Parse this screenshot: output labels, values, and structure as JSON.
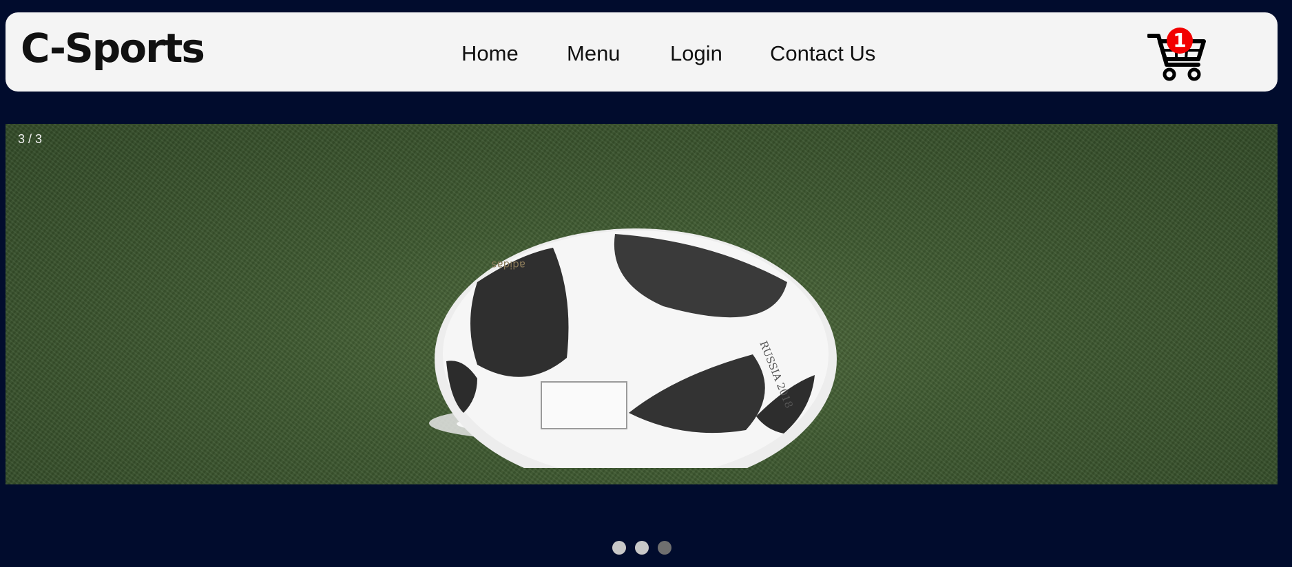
{
  "header": {
    "brand": "C-Sports",
    "nav": [
      {
        "label": "Home"
      },
      {
        "label": "Menu"
      },
      {
        "label": "Login"
      },
      {
        "label": "Contact Us"
      }
    ],
    "cart": {
      "icon": "cart-icon",
      "count": "1"
    }
  },
  "slideshow": {
    "counter": "3 / 3",
    "slide_image": "soccer-ball-on-pitch",
    "ball_print": "RUSSIA 2018",
    "ball_brand": "adidas",
    "active_index": 3,
    "dots": [
      {
        "index": 1
      },
      {
        "index": 2
      },
      {
        "index": 3
      }
    ]
  },
  "colors": {
    "page_bg": "#010c2d",
    "nav_bg": "#f4f4f4",
    "badge": "#f20000",
    "dot": "#c8c8c8",
    "dot_active": "#6f6f6f"
  }
}
